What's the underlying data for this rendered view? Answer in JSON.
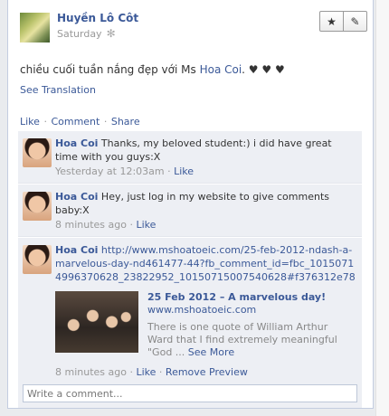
{
  "post": {
    "author": "Huyền Lô Côt",
    "time": "Saturday",
    "text_before": "chiều cuối tuần nắng đẹp với Ms",
    "mention": "Hoa Coi",
    "text_after": ". ♥ ♥ ♥",
    "see_translation": "See Translation",
    "actions": {
      "star": "★",
      "edit": "✎"
    },
    "gear": "✻"
  },
  "feedback": {
    "like": "Like",
    "comment": "Comment",
    "share": "Share",
    "sep": "·"
  },
  "comments": [
    {
      "name": "Hoa Coi",
      "text": "Thanks, my beloved student:) i did have great time with you guys:X",
      "time": "Yesterday at 12:03am",
      "like": "Like"
    },
    {
      "name": "Hoa Coi",
      "text": "Hey, just log in my website to give comments baby:X",
      "time": "8 minutes ago",
      "like": "Like"
    },
    {
      "name": "Hoa Coi",
      "url": "http://www.mshoatoeic.com/25-feb-2012-ndash-a-marvelous-day-nd461477-44?fb_comment_id=fbc_10150714996370628_23822952_10150715007540628#f376312e78",
      "preview": {
        "title": "25 Feb 2012 – A marvelous day!",
        "domain": "www.mshoatoeic.com",
        "description": "There is one quote of William Arthur Ward that I find extremely meaningful \"God ...",
        "see_more": "See More"
      },
      "time": "8 minutes ago",
      "like": "Like",
      "remove_preview": "Remove Preview"
    }
  ],
  "composer": {
    "placeholder": "Write a comment..."
  }
}
